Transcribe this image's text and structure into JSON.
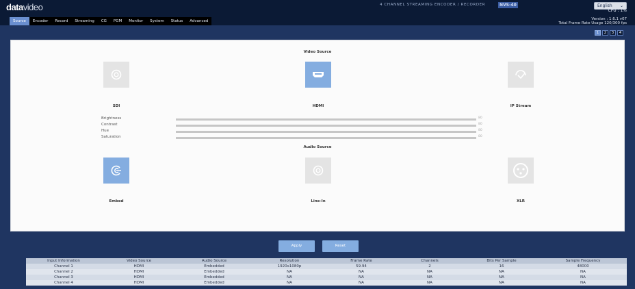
{
  "header": {
    "logo_bold": "data",
    "logo_thin": "video",
    "product_name": "4 CHANNEL STREAMING ENCODER / RECORDER",
    "model": "NVS-40",
    "language": "English",
    "cpu": "CPU : 1%",
    "version": "Version : 1.6.1 v07",
    "frame_rate_usage": "Total Frame Rate Usage 120/300 fps"
  },
  "tabs": [
    {
      "label": "Source",
      "active": true
    },
    {
      "label": "Encoder"
    },
    {
      "label": "Record"
    },
    {
      "label": "Streaming"
    },
    {
      "label": "CG"
    },
    {
      "label": "PGM"
    },
    {
      "label": "Monitor"
    },
    {
      "label": "System"
    },
    {
      "label": "Status"
    },
    {
      "label": "Advanced"
    }
  ],
  "page_nav": [
    "1",
    "2",
    "3",
    "4"
  ],
  "video_source": {
    "title": "Video Source",
    "options": [
      {
        "label": "SDI",
        "icon": "sdi-connector-icon"
      },
      {
        "label": "HDMI",
        "icon": "hdmi-port-icon",
        "selected": true
      },
      {
        "label": "IP Stream",
        "icon": "ip-stream-icon"
      }
    ]
  },
  "adjustments": [
    {
      "label": "Brightness",
      "value": "80"
    },
    {
      "label": "Contrast",
      "value": "80"
    },
    {
      "label": "Hue",
      "value": "80"
    },
    {
      "label": "Saturation",
      "value": "80"
    }
  ],
  "audio_source": {
    "title": "Audio Source",
    "options": [
      {
        "label": "Embed",
        "icon": "embed-audio-icon",
        "selected": true
      },
      {
        "label": "Line-In",
        "icon": "line-in-icon"
      },
      {
        "label": "XLR",
        "icon": "xlr-connector-icon"
      }
    ]
  },
  "buttons": {
    "apply": "Apply",
    "reset": "Reset"
  },
  "info_table": {
    "headers": [
      "Input Information",
      "Video Source",
      "Audio Source",
      "Resolution",
      "Frame Rate",
      "Channels",
      "Bits Per Sample",
      "Sample Frequency"
    ],
    "rows": [
      [
        "Channel 1",
        "HDMI",
        "Embedded",
        "1920x1080p",
        "59.94",
        "2",
        "16",
        "48000"
      ],
      [
        "Channel 2",
        "HDMI",
        "Embedded",
        "NA",
        "NA",
        "NA",
        "NA",
        "NA"
      ],
      [
        "Channel 3",
        "HDMI",
        "Embedded",
        "NA",
        "NA",
        "NA",
        "NA",
        "NA"
      ],
      [
        "Channel 4",
        "HDMI",
        "Embedded",
        "NA",
        "NA",
        "NA",
        "NA",
        "NA"
      ]
    ]
  },
  "colors": {
    "background": "#1f3561",
    "accent": "#6a8fd0",
    "selected_tile": "#84ade0"
  }
}
